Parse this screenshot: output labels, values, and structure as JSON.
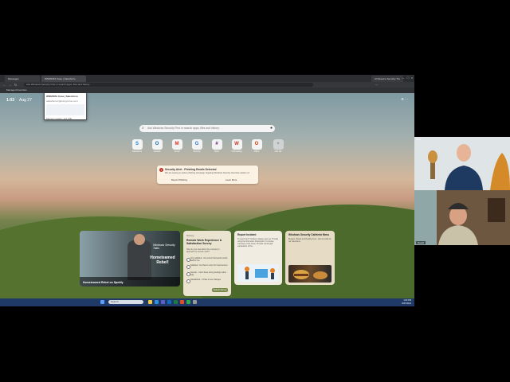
{
  "browser": {
    "tabs": [
      {
        "label": "Messages"
      },
      {
        "label": "WNS5N51 Case | Salesforce"
      },
      {
        "label": "AI Resume Security Tra"
      }
    ],
    "address": "Ask Windows Security First or search apps, files and history",
    "favorites_bar": "Managed Favorites"
  },
  "newtab": {
    "time": "1:03",
    "date": "Aug 27",
    "search_placeholder": "Ask Windows Security First or search apps, files and history",
    "quick_links": [
      {
        "label": "Salesforce",
        "glyph": "S",
        "color": "#1a8bd6"
      },
      {
        "label": "Outlook",
        "glyph": "O",
        "color": "#0f6cbd"
      },
      {
        "label": "Gmail",
        "glyph": "M",
        "color": "#d93025"
      },
      {
        "label": "Security",
        "glyph": "G",
        "color": "#2a7ae2"
      },
      {
        "label": "Slack",
        "glyph": "#",
        "color": "#611f69"
      },
      {
        "label": "Onboarding",
        "glyph": "W",
        "color": "#c0392b"
      },
      {
        "label": "Office",
        "glyph": "O",
        "color": "#d83b01"
      },
      {
        "label": "Add site",
        "glyph": "+",
        "color": "#888888"
      }
    ]
  },
  "alert": {
    "title": "Security Alert - Phishing Emails Detected",
    "body": "We are seeing an active phishing campaign targeting Windows Security. Exercise caution on",
    "report_label": "Report Phishing",
    "learn_label": "Learn More"
  },
  "popup": {
    "title": "WNS5N51 Case | Salesforce",
    "subtitle": "salesforce.lightning.force.com",
    "memory": "Memory usage: 121 MB"
  },
  "cards": {
    "story": {
      "brand": "Windows Security Talks",
      "headline": "Hometeamed Rebel!",
      "title": "Hometeamed Rebel on Spotify"
    },
    "survey": {
      "header": "Survey",
      "title": "Remote Work Experience & Satisfaction Survey",
      "desc": "How do you feel about the company's approach to remote work?",
      "options": [
        "Very satisfied - the current framework works well for me",
        "Satisfied - but there's room for improvement",
        "Neutral - I don't have strong feelings either way",
        "Dissatisfied - I'd like to see changes"
      ],
      "submit": "Submit Survey"
    },
    "incident": {
      "title": "Report Incident",
      "desc": "To report an IT incident, please open an IT ticket using the link below. Description: A concise summary of the issue. Provide a thorough explanation of the..."
    },
    "cafeteria": {
      "title": "Windows Security Cafeteria Menu",
      "desc": "Burgers, Bowls and Healthy Fuel - stop by Café for our selections."
    }
  },
  "taskbar": {
    "search_label": "Search",
    "time": "1:03 PM",
    "date": "8/27/2024"
  },
  "video": {
    "participant1": "Host",
    "participant2": "Guest"
  }
}
